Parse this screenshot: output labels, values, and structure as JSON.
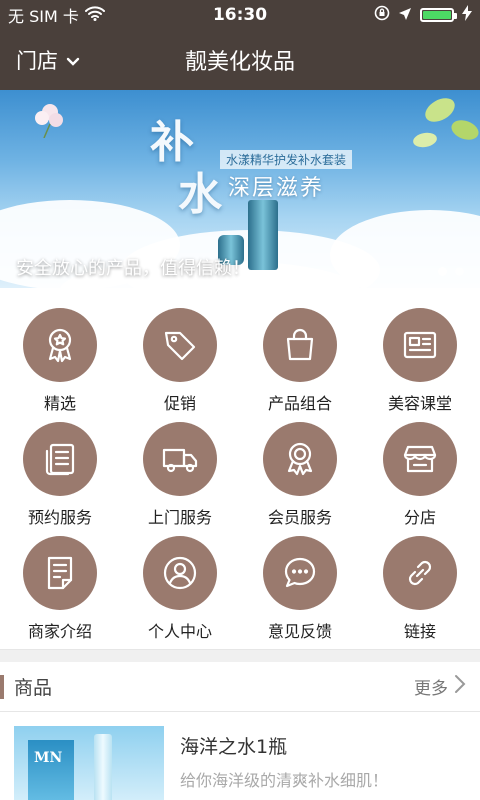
{
  "status_bar": {
    "carrier": "无 SIM 卡",
    "time": "16:30",
    "icons": [
      "wifi-icon",
      "orientation-lock-icon",
      "location-icon",
      "battery-icon",
      "charging-icon"
    ],
    "battery_level": 1.0
  },
  "navbar": {
    "store_label": "门店",
    "title": "靓美化妆品",
    "background": "#4a403b"
  },
  "banner": {
    "big_char_1": "补",
    "big_char_2": "水",
    "subtitle_small": "水漾精华护发补水套装",
    "subtitle_large": "深层滋养",
    "caption": "安全放心的产品，值得信赖！",
    "slides": 2,
    "active_slide": 1
  },
  "menu": {
    "accent": "#9a7a6e",
    "items": [
      {
        "label": "精选",
        "icon": "award-icon"
      },
      {
        "label": "促销",
        "icon": "tag-icon"
      },
      {
        "label": "产品组合",
        "icon": "shopping-bag-icon"
      },
      {
        "label": "美容课堂",
        "icon": "newspaper-icon"
      },
      {
        "label": "预约服务",
        "icon": "notepad-icon"
      },
      {
        "label": "上门服务",
        "icon": "truck-icon"
      },
      {
        "label": "会员服务",
        "icon": "member-badge-icon"
      },
      {
        "label": "分店",
        "icon": "store-icon"
      },
      {
        "label": "商家介绍",
        "icon": "document-icon"
      },
      {
        "label": "个人中心",
        "icon": "user-icon"
      },
      {
        "label": "意见反馈",
        "icon": "chat-bubble-icon"
      },
      {
        "label": "链接",
        "icon": "link-icon"
      }
    ]
  },
  "products_section": {
    "title": "商品",
    "more_label": "更多",
    "items": [
      {
        "name": "海洋之水1瓶",
        "desc": "给你海洋级的清爽补水细肌！",
        "thumb_brand": "MN"
      }
    ]
  }
}
